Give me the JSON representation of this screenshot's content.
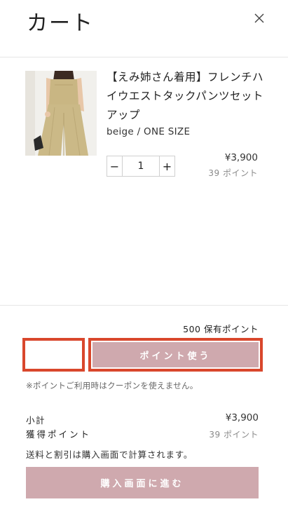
{
  "header": {
    "title": "カート",
    "close_icon": "close-icon"
  },
  "cart_item": {
    "image_icon": "product-photo",
    "name": "【えみ姉さん着用】フレンチハイウエストタックパンツセットアップ",
    "variant": "beige / ONE SIZE",
    "quantity": "1",
    "minus_label": "−",
    "plus_label": "+",
    "price": "¥3,900",
    "points": "39 ポイント"
  },
  "points_section": {
    "held_points": "500 保有ポイント",
    "input_value": "",
    "use_button_label": "ポイント使う",
    "note": "※ポイントご利用時はクーポンを使えません。",
    "highlight_color": "#d9472c"
  },
  "summary": {
    "subtotal_label": "小計",
    "subtotal_value": "¥3,900",
    "earn_label": "獲得ポイント",
    "earn_value": "39 ポイント",
    "shipping_note": "送料と割引は購入画面で計算されます。",
    "checkout_label": "購入画面に進む"
  },
  "colors": {
    "accent": "#cfa9ae",
    "text": "#222222",
    "muted": "#8a8a8a"
  }
}
